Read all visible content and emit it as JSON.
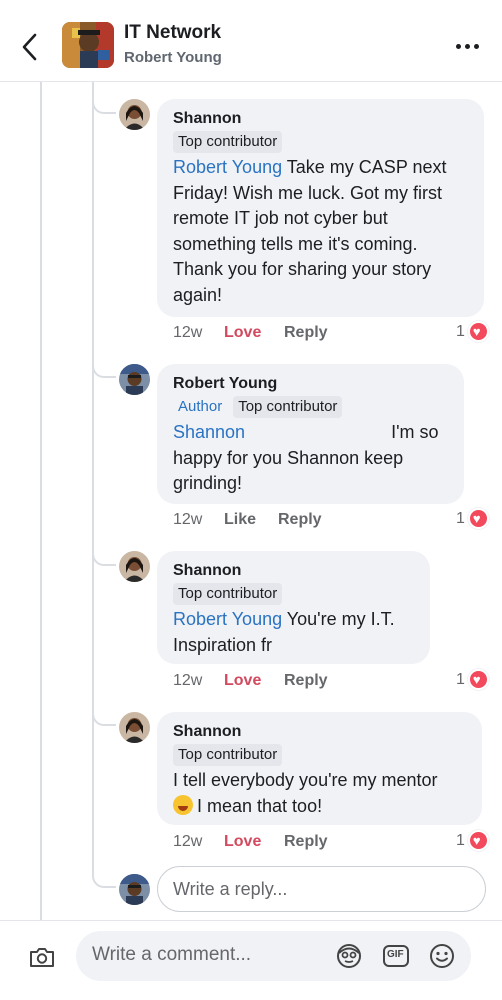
{
  "header": {
    "title": "IT Network",
    "subtitle": "Robert Young"
  },
  "comments": [
    {
      "author": "Shannon",
      "badges": [
        "Top contributor"
      ],
      "mention": "Robert Young",
      "lines": [
        " Take my CASP next",
        "Friday! Wish me luck. Got my first",
        "remote IT job not cyber but",
        "something tells me it's coming.",
        "Thank you for sharing your story",
        "again!"
      ],
      "time": "12w",
      "action": "Love",
      "reply_label": "Reply",
      "reaction_count": "1"
    },
    {
      "author": "Robert Young",
      "author_badge": "Author",
      "badges": [
        "Top contributor"
      ],
      "mention": "Shannon",
      "lines": [
        "I'm so",
        "happy for you Shannon keep",
        "grinding!"
      ],
      "time": "12w",
      "action": "Like",
      "reply_label": "Reply",
      "reaction_count": "1"
    },
    {
      "author": "Shannon",
      "badges": [
        "Top contributor"
      ],
      "mention": "Robert Young",
      "lines": [
        " You're my I.T.",
        "Inspiration fr"
      ],
      "time": "12w",
      "action": "Love",
      "reply_label": "Reply",
      "reaction_count": "1"
    },
    {
      "author": "Shannon",
      "badges": [
        "Top contributor"
      ],
      "lines": [
        "I tell everybody you're my mentor",
        "I mean that too!"
      ],
      "time": "12w",
      "action": "Love",
      "reply_label": "Reply",
      "reaction_count": "1"
    }
  ],
  "reply_box": {
    "placeholder": "Write a reply..."
  },
  "bottom_bar": {
    "placeholder": "Write a comment...",
    "gif_label": "GIF"
  },
  "colors": {
    "mention": "#2a73c2",
    "love": "#d14a5f",
    "bubble": "#f0f2f5",
    "heart": "#f2495c"
  }
}
